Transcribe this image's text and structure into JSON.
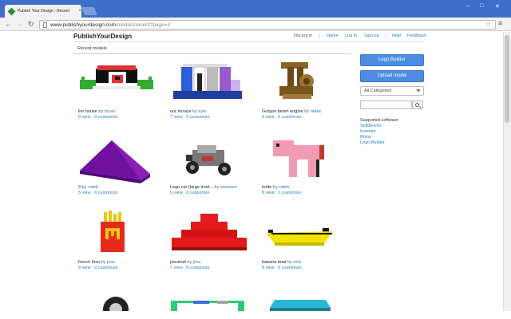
{
  "browser": {
    "tab_title": "Publish Your Design - Recent",
    "tab_close": "×",
    "url_host": "www.publishyourdesign.com",
    "url_path": "/models/recent?page=3",
    "win_minimize": "–",
    "win_maximize": "□",
    "win_close": "✕"
  },
  "site": {
    "logo": "PublishYourDesign",
    "nav": {
      "not_logged_in": "Not log in",
      "home": "Home",
      "log_in": "Log in",
      "sign_up": "Sign up",
      "help": "Help",
      "feedback": "Feedback",
      "separator": "|"
    }
  },
  "section_title": "Recent models",
  "models": [
    {
      "name": "lior house",
      "by": "by",
      "author": "bryan",
      "views": "8 view",
      "customize": "0 customize"
    },
    {
      "name": "our terrace",
      "by": "by",
      "author": "kyle",
      "views": "7 view",
      "customize": "0 customize"
    },
    {
      "name": "Gorgon beam engine",
      "by": "by",
      "author": "ratiax",
      "views": "9 view",
      "customize": "0 customize"
    },
    {
      "name": "3",
      "by": "by",
      "author": "caleb",
      "views": "5 view",
      "customize": "0 customize"
    },
    {
      "name": "Lego car (large mod...",
      "by": "by",
      "author": "mansoor",
      "views": "9 view",
      "customize": "0 customize"
    },
    {
      "name": "turtle",
      "by": "by",
      "author": "caleb",
      "views": "9 view",
      "customize": "1 customize"
    },
    {
      "name": "french fries",
      "by": "by",
      "author": "jess",
      "views": "8 view",
      "customize": "0 customize"
    },
    {
      "name": "peramid",
      "by": "by",
      "author": "jess",
      "views": "7 view",
      "customize": "0 customize"
    },
    {
      "name": "banana boat",
      "by": "by",
      "author": "nick",
      "views": "8 view",
      "customize": "0 customize"
    }
  ],
  "sidebar": {
    "lego_builder_button": "Lego Builder",
    "upload_button": "Upload model",
    "category_select": "All Categories",
    "supported_heading": "Supported software",
    "software": [
      "Solidworks",
      "Inventor",
      "Rhino",
      "Lego Builder"
    ]
  },
  "colors": {
    "accent": "#4c8ce3",
    "link": "#2980b9",
    "chrome_tabbar": "#3e6ec9"
  }
}
